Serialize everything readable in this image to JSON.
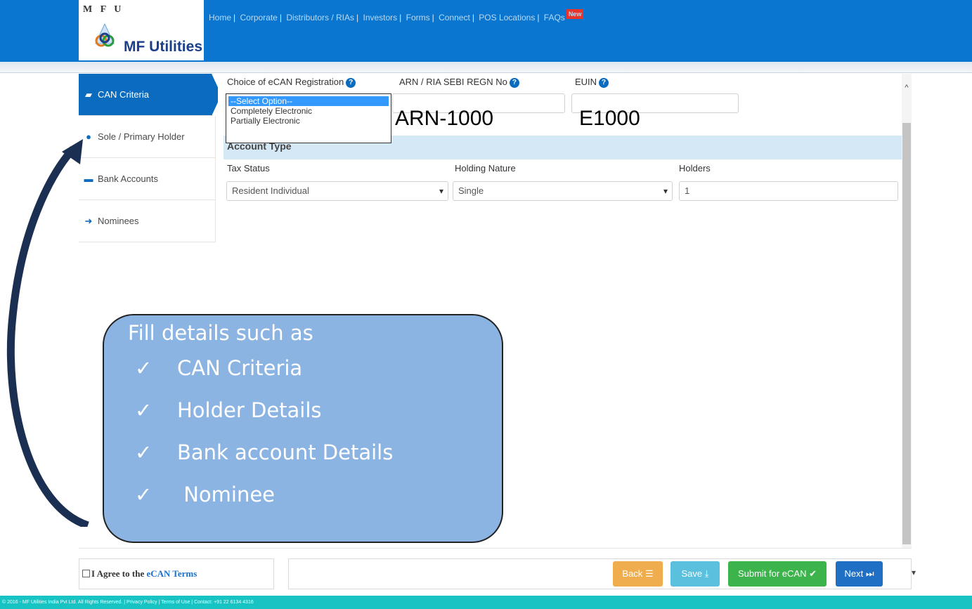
{
  "header": {
    "logo_letters": "M F U",
    "logo_text": "MF Utilities",
    "nav": [
      "Home",
      "Corporate",
      "Distributors / RIAs",
      "Investors",
      "Forms",
      "Connect",
      "POS Locations",
      "FAQs"
    ],
    "new_badge": "New"
  },
  "sidebar": {
    "items": [
      {
        "label": "CAN Criteria",
        "icon": "briefcase-icon"
      },
      {
        "label": "Sole / Primary Holder",
        "icon": "user-icon"
      },
      {
        "label": "Bank Accounts",
        "icon": "bank-card-icon"
      },
      {
        "label": "Nominees",
        "icon": "arrow-right-icon"
      }
    ]
  },
  "form": {
    "choice_label": "Choice of eCAN Registration",
    "choice_options": [
      "--Select Option--",
      "Completely Electronic",
      "Partially Electronic"
    ],
    "arn_label": "ARN / RIA SEBI REGN No",
    "arn_value": "ARN-1000",
    "euin_label": "EUIN",
    "euin_value": "E1000",
    "section_title": "Account Type",
    "tax_status_label": "Tax Status",
    "tax_status_value": "Resident Individual",
    "holding_nature_label": "Holding Nature",
    "holding_nature_value": "Single",
    "holders_label": "Holders",
    "holders_value": "1"
  },
  "bottom": {
    "agree_prefix": "I Agree to the ",
    "agree_link": "eCAN Terms",
    "back_label": "Back",
    "save_label": "Save",
    "submit_label": "Submit for eCAN",
    "next_label": "Next"
  },
  "footer": {
    "text": "© 2016 - MF Utilities India Pvt Ltd. All Rights Reserved.  |  Privacy Policy  |  Terms of Use  |  Contact: +91 22 6134 4316"
  },
  "callout": {
    "title": "Fill details such as",
    "tick": "✓",
    "items": [
      "CAN Criteria",
      "Holder Details",
      "Bank account Details",
      " Nominee"
    ]
  },
  "colors": {
    "header_blue": "#0a76cf",
    "active_tab": "#0a6bbf",
    "callout_fill": "#8cb4e2",
    "arrow": "#1a2f52",
    "back_btn": "#f0ad4e",
    "save_btn": "#5bc0de",
    "submit_btn": "#3cb44b",
    "next_btn": "#1f6fc4",
    "footer": "#17c3c3"
  }
}
